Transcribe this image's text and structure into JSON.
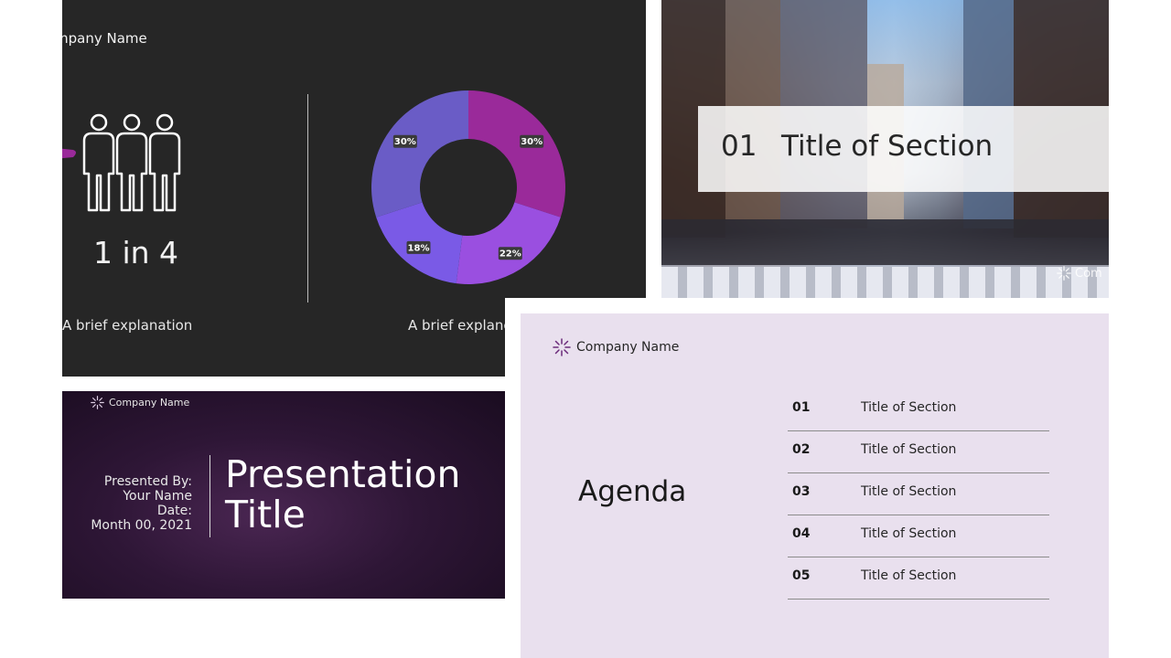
{
  "stats_slide": {
    "company": "mpany Name",
    "stat": "1 in 4",
    "explanation_left": "A brief explanation",
    "explanation_right": "A brief explanc",
    "chart_data": {
      "type": "pie",
      "slices": [
        {
          "label": "30%",
          "value": 30,
          "color": "#9a2a9a"
        },
        {
          "label": "22%",
          "value": 22,
          "color": "#9a4fe0"
        },
        {
          "label": "18%",
          "value": 18,
          "color": "#7a5ae6"
        },
        {
          "label": "30%",
          "value": 30,
          "color": "#6a5cc6"
        }
      ]
    }
  },
  "section_slide": {
    "number": "01",
    "title": "Title of Section",
    "corner_text": "Com"
  },
  "title_slide": {
    "company": "Company Name",
    "presented_by": "Presented By:",
    "name": "Your Name",
    "date_label": "Date:",
    "date": "Month 00, 2021",
    "title_line1": "Presentation",
    "title_line2": "Title"
  },
  "agenda_slide": {
    "company": "Company Name",
    "title": "Agenda",
    "items": [
      {
        "num": "01",
        "title": "Title of Section"
      },
      {
        "num": "02",
        "title": "Title of Section"
      },
      {
        "num": "03",
        "title": "Title of Section"
      },
      {
        "num": "04",
        "title": "Title of Section"
      },
      {
        "num": "05",
        "title": "Title of Section"
      }
    ]
  },
  "colors": {
    "accent": "#9a2a9a",
    "dark_bg": "#262626",
    "agenda_bg": "#e9e0ee"
  }
}
